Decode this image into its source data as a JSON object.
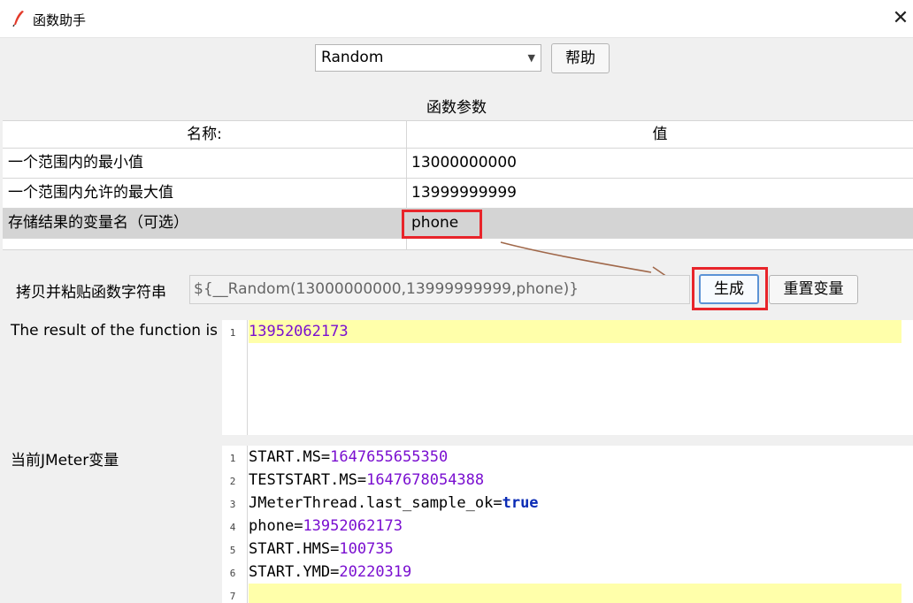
{
  "window": {
    "title": "函数助手",
    "close_glyph": "✕",
    "icon": "feather-icon"
  },
  "controls": {
    "selected_function": "Random",
    "help_label": "帮助"
  },
  "params": {
    "title": "函数参数",
    "header_name": "名称:",
    "header_value": "值",
    "rows": [
      {
        "name": "一个范围内的最小值",
        "value": "13000000000"
      },
      {
        "name": "一个范围内允许的最大值",
        "value": "13999999999"
      },
      {
        "name": "存储结果的变量名（可选）",
        "value": "phone"
      }
    ]
  },
  "copy": {
    "label": "拷贝并粘贴函数字符串",
    "function_string": "${__Random(13000000000,13999999999,phone)}",
    "generate_label": "生成",
    "reset_label": "重置变量"
  },
  "result": {
    "label": "The result of the function is",
    "lines": [
      {
        "num": "1",
        "value": "13952062173"
      }
    ]
  },
  "variables": {
    "label": "当前JMeter变量",
    "lines": [
      {
        "num": "1",
        "key": "START.MS",
        "eq": "=",
        "value": "1647655655350"
      },
      {
        "num": "2",
        "key": "TESTSTART.MS",
        "eq": "=",
        "value": "1647678054388"
      },
      {
        "num": "3",
        "key": "JMeterThread.last_sample_ok",
        "eq": "=",
        "value": "true"
      },
      {
        "num": "4",
        "key": "phone",
        "eq": "=",
        "value": "13952062173"
      },
      {
        "num": "5",
        "key": "START.HMS",
        "eq": "=",
        "value": "100735"
      },
      {
        "num": "6",
        "key": "START.YMD",
        "eq": "=",
        "value": "20220319"
      },
      {
        "num": "7",
        "key": "",
        "eq": "",
        "value": ""
      }
    ]
  },
  "colors": {
    "highlight_red": "#e8242a",
    "number_purple": "#7a0fd0",
    "keyword_blue": "#0a2bb5",
    "line_highlight": "#ffffaa",
    "arrow_brown": "#a0684a"
  }
}
